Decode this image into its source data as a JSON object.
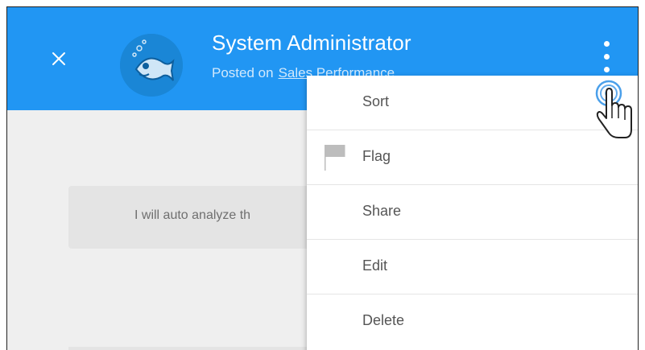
{
  "header": {
    "title": "System Administrator",
    "posted_on": "Posted on",
    "source": "Sales Performance",
    "bg_color": "#2196f3"
  },
  "comment": {
    "text": "I will auto analyze th"
  },
  "menu": {
    "items": [
      {
        "label": "Sort",
        "icon": ""
      },
      {
        "label": "Flag",
        "icon": "flag-icon"
      },
      {
        "label": "Share",
        "icon": ""
      },
      {
        "label": "Edit",
        "icon": ""
      },
      {
        "label": "Delete",
        "icon": ""
      }
    ]
  },
  "icons": {
    "close": "close-icon",
    "more": "more-vertical-icon",
    "avatar": "fish-avatar",
    "cursor": "hand-pointer-icon"
  }
}
